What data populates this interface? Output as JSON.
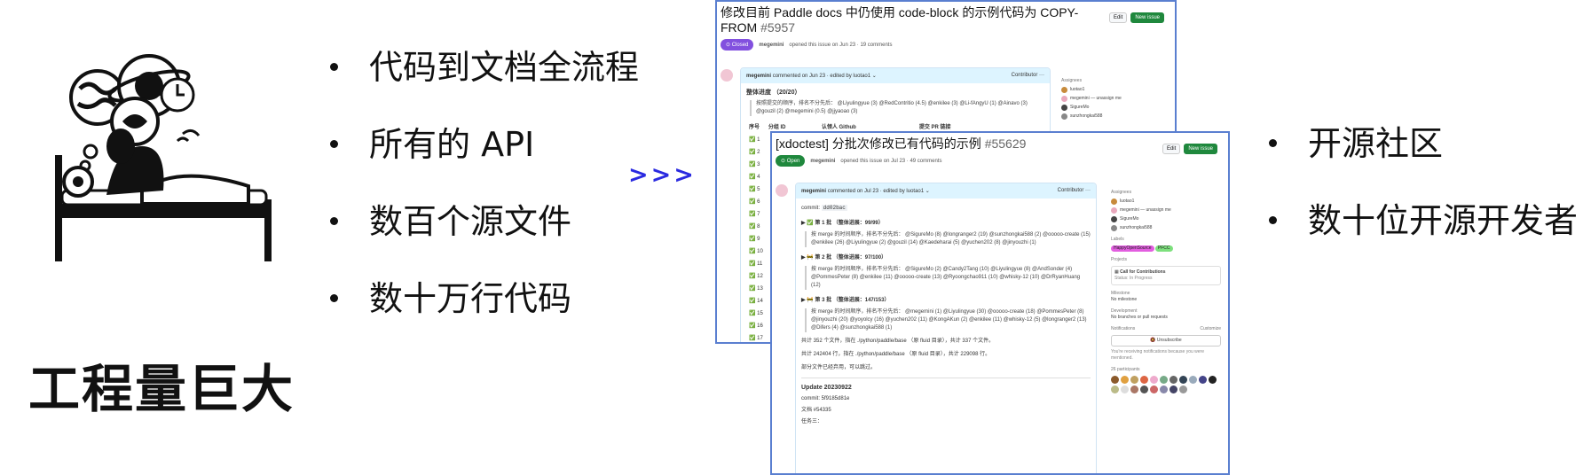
{
  "left_bullets": [
    "代码到文档全流程",
    "所有的 API",
    "数百个源文件",
    "数十万行代码"
  ],
  "big_title": "工程量巨大",
  "arrow": ">>>",
  "right_bullets": [
    "开源社区",
    "数十位开源开发者"
  ],
  "issue1": {
    "title": "修改目前 Paddle docs 中仍使用 code-block 的示例代码为 COPY-FROM",
    "number": "#5957",
    "state": "Closed",
    "edit_label": "Edit",
    "new_issue_label": "New issue",
    "opener": "megemini",
    "opened_text": "opened this issue on Jun 23 · 19 comments",
    "comment_author": "megemini",
    "comment_meta": "commented on Jun 23 · edited by luotao1",
    "role": "Contributor",
    "progress_heading": "整体进度 （20/20）",
    "contrib_line1": "按照提交的顺序，排名不分先后： @Liyulingyue (3) @RedContritio (4.5) @enkilee (3) @Li-fAngyU (1) @Ainavo (3)",
    "contrib_line2": "@gouzil (2) @megemini (0.5) @jjyaoao (3)",
    "table_headers": [
      "序号",
      "分组 ID",
      "认领人 Github",
      "提交 PR 链接"
    ],
    "rows": [
      "1",
      "2",
      "3",
      "4",
      "5",
      "6",
      "7",
      "8",
      "9",
      "10",
      "11",
      "12",
      "13",
      "14",
      "15",
      "16",
      "17"
    ],
    "assignees_heading": "Assignees",
    "assignees": [
      "luotao1",
      "megemini — unassign me",
      "SigureMo",
      "sunzhongkai588"
    ]
  },
  "issue2": {
    "title": "[xdoctest] 分批次修改已有代码的示例",
    "number": "#55629",
    "state": "Open",
    "edit_label": "Edit",
    "new_issue_label": "New issue",
    "opener": "megemini",
    "opened_text": "opened this issue on Jul 23 · 49 comments",
    "comment_author": "megemini",
    "comment_meta": "commented on Jul 23 · edited by luotao1",
    "role": "Contributor",
    "commit_label": "commit:",
    "commit_hash": "dd02bac",
    "batch1_title": "▶ ✅ 第 1 批 （整体进展：99/99）",
    "batch1_line1": "按 merge 的时间顺序，排名不分先后： @SigureMo (8) @longranger2 (19) @sunzhongkai588 (2) @ooooo-create (15)",
    "batch1_line2": "@enkilee (26) @Liyulingyue (2) @gouzil (14) @Kaedeharai (5) @yuchen202 (8) @jinyouzhi (1)",
    "batch2_title": "▶ 🚧 第 2 批 （整体进展：97/100）",
    "batch2_line1": "按 merge 的时间顺序，排名不分先后： @SigureMo (2) @Candy2Tang (10) @Liyulingyue (8) @AndSonder (4)",
    "batch2_line2": "@PommesPeter (8) @enkilee (11) @ooooo-create (13) @Ryoongchao911 (10) @whisky-12 (10) @DrRyanHuang (12)",
    "batch3_title": "▶ 🚧 第 3 批 （整体进展：147/153）",
    "batch3_line1": "按 merge 的时间顺序，排名不分先后： @megemini (1) @Liyulingyue (30) @ooooo-create (18) @PommesPeter (8)",
    "batch3_line2": "@jinyouzhi (20) @yoyolcy (16) @yuchen202 (11) @KongAKun (2) @enkilee (11) @whisky-12 (5) @longranger2 (13)",
    "batch3_line3": "@Difers (4) @sunzhongkai588 (1)",
    "stat1": "共计 352 个文件，指在 ./python/paddle/base （原 fluid 目录），共计 337 个文件。",
    "stat2": "共计 242404 行，指在 ./python/paddle/base （原 fluid 目录），共计 229098 行。",
    "stat3": "部分文件已经弃用，可以跳过。",
    "update_title": "Update 20230922",
    "update_commit": "commit: 5f9185d81e",
    "update_ref": "文档 #54335",
    "update_task": "任务三：",
    "assignees_heading": "Assignees",
    "assignees": [
      "luotao1",
      "megemini — unassign me",
      "SigureMo",
      "sunzhongkai588"
    ],
    "labels_heading": "Labels",
    "labels": [
      "HappyOpenSource",
      "PFCC"
    ],
    "projects_heading": "Projects",
    "project_name": "Call for Contributions",
    "project_status": "Status: In Progress",
    "milestone_heading": "Milestone",
    "milestone_value": "No milestone",
    "dev_heading": "Development",
    "dev_value": "No branches or pull requests",
    "notif_heading": "Notifications",
    "customize": "Customize",
    "unsubscribe": "Unsubscribe",
    "notif_note": "You're receiving notifications because you were mentioned.",
    "participants": "26 participants"
  },
  "colors": {
    "accent_blue": "#2a2ae0",
    "closed_purple": "#8250df",
    "open_green": "#1f883d"
  }
}
